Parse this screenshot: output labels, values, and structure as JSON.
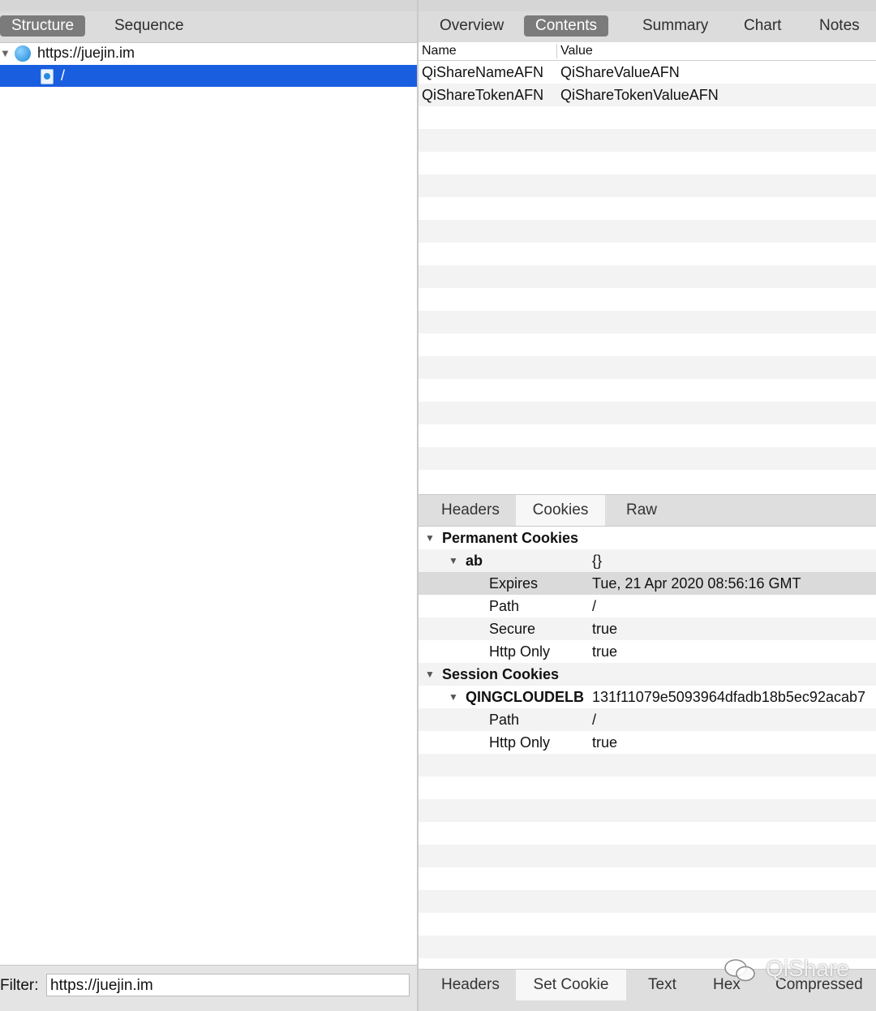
{
  "left": {
    "tabs": [
      {
        "label": "Structure",
        "selected": true
      },
      {
        "label": "Sequence",
        "selected": false
      }
    ],
    "tree": {
      "host": "https://juejin.im",
      "child": "/"
    },
    "filter": {
      "label": "Filter:",
      "value": "https://juejin.im"
    }
  },
  "right": {
    "tabs": [
      {
        "label": "Overview",
        "selected": false
      },
      {
        "label": "Contents",
        "selected": true
      },
      {
        "label": "Summary",
        "selected": false
      },
      {
        "label": "Chart",
        "selected": false
      },
      {
        "label": "Notes",
        "selected": false
      }
    ],
    "table": {
      "headers": [
        "Name",
        "Value"
      ],
      "rows": [
        [
          "QiShareNameAFN",
          "QiShareValueAFN"
        ],
        [
          "QiShareTokenAFN",
          "QiShareTokenValueAFN"
        ]
      ]
    },
    "request_tabs": [
      {
        "label": "Headers",
        "active": false
      },
      {
        "label": "Cookies",
        "active": true
      },
      {
        "label": "Raw",
        "active": false
      }
    ],
    "cookies": {
      "permanent_label": "Permanent Cookies",
      "permanent": {
        "name": "ab",
        "value": "{}",
        "attrs": [
          [
            "Expires",
            "Tue, 21 Apr 2020 08:56:16 GMT"
          ],
          [
            "Path",
            "/"
          ],
          [
            "Secure",
            "true"
          ],
          [
            "Http Only",
            "true"
          ]
        ]
      },
      "session_label": "Session Cookies",
      "session": {
        "name": "QINGCLOUDELB",
        "value": "131f11079e5093964dfadb18b5ec92acab7",
        "attrs": [
          [
            "Path",
            "/"
          ],
          [
            "Http Only",
            "true"
          ]
        ]
      }
    },
    "response_tabs": [
      {
        "label": "Headers",
        "active": false
      },
      {
        "label": "Set Cookie",
        "active": true
      },
      {
        "label": "Text",
        "active": false
      },
      {
        "label": "Hex",
        "active": false
      },
      {
        "label": "Compressed",
        "active": false
      }
    ],
    "watermark": "QiShare"
  },
  "colors": {
    "selection": "#1a5ee0",
    "tab_selected": "#7b7b7b"
  }
}
